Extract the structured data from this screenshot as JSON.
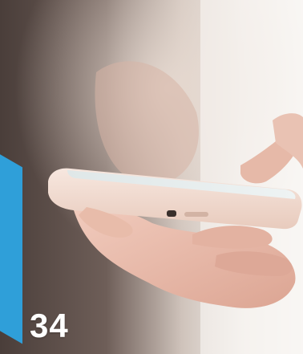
{
  "slide": {
    "page_number": "34",
    "accent_color": "#2f9fd9",
    "background_image": "hand-holding-smartphone-photo"
  }
}
